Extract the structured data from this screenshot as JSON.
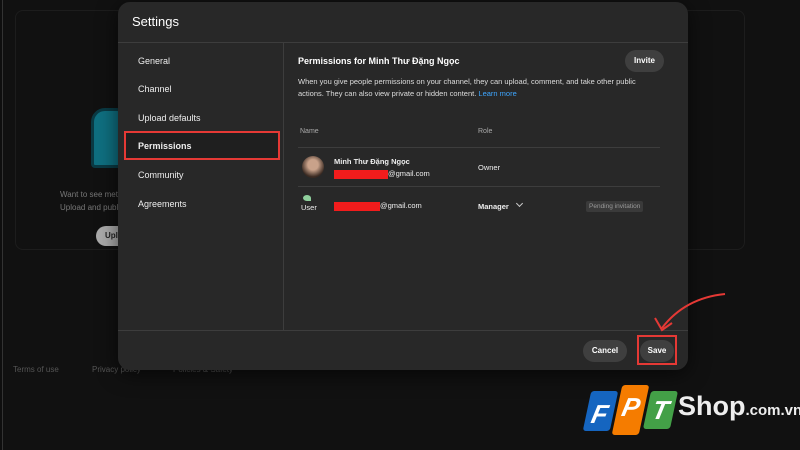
{
  "background": {
    "empty_text_1": "Want to see metri",
    "empty_text_2": "Upload and publis",
    "upload_button": "Uplo",
    "footer": [
      "Terms of use",
      "Privacy policy",
      "Policies & Safety"
    ]
  },
  "modal": {
    "title": "Settings",
    "sidebar": [
      {
        "label": "General"
      },
      {
        "label": "Channel"
      },
      {
        "label": "Upload defaults"
      },
      {
        "label": "Permissions",
        "active": true
      },
      {
        "label": "Community"
      },
      {
        "label": "Agreements"
      }
    ],
    "permissions": {
      "title": "Permissions for Minh Thư Đặng Ngọc",
      "invite_label": "Invite",
      "description": "When you give people permissions on your channel, they can upload, comment, and take other public actions. They can also view private or hidden content.",
      "learn_more": "Learn more",
      "columns": {
        "name": "Name",
        "role": "Role"
      },
      "rows": [
        {
          "name": "Minh Thư Đặng Ngọc",
          "email_suffix": "@gmail.com",
          "role": "Owner",
          "avatar": "photo"
        },
        {
          "name": "User",
          "email_suffix": "@gmail.com",
          "role": "Manager",
          "status": "Pending invitation",
          "avatar": "user-icon"
        }
      ]
    },
    "cancel_label": "Cancel",
    "save_label": "Save"
  },
  "annotation": {
    "highlight_color": "#e53935"
  },
  "watermark": {
    "brand": "FPT Shop.com.vn",
    "letters": [
      "F",
      "P",
      "T"
    ],
    "colors": [
      "#1565c0",
      "#f57c00",
      "#43a047"
    ],
    "shop": "Shop",
    "domain": ".com.vn"
  }
}
